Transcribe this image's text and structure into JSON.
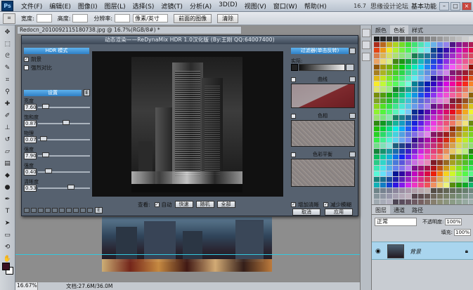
{
  "app": {
    "logo": "Ps",
    "menu": [
      "文件(F)",
      "编辑(E)",
      "图像(I)",
      "图层(L)",
      "选择(S)",
      "滤镜(T)",
      "分析(A)",
      "3D(D)",
      "视图(V)",
      "窗口(W)",
      "帮助(H)"
    ],
    "zoom_display": "16.7",
    "site_watermark": "思缘设计论坛",
    "workspace": "基本功能"
  },
  "options_bar": {
    "width_label": "宽度:",
    "height_label": "高度:",
    "resolution_label": "分辨率:",
    "unit_select": "像素/英寸",
    "front_image_button": "前面的图像",
    "clear_button": "清除"
  },
  "document": {
    "tab": "Redocn_2010092115180738.jpg @ 16.7%(RGB/8#) *",
    "zoom": "16.67%",
    "doc_info": "文档:27.6M/36.0M"
  },
  "dialog": {
    "title": "动态渲染——ReDynaMix HDR 1.0汉化版 (By:王刚  QQ:64007400)",
    "hdr_mode": "HDR 模式",
    "checks": [
      {
        "label": "阴景",
        "checked": true
      },
      {
        "label": "强烈对比",
        "checked": false
      }
    ],
    "settings_header": "设置",
    "settings_btn": "E",
    "params": [
      {
        "label": "亮度",
        "value": "7.60",
        "level": 0.1
      },
      {
        "label": "饱和度",
        "value": "0.87",
        "level": 0.55
      },
      {
        "label": "物理",
        "value": "0.07",
        "level": 0.05
      },
      {
        "label": "强度",
        "value": "7.90",
        "level": 0.1
      },
      {
        "label": "强度",
        "value": "0.40",
        "level": 0.15
      },
      {
        "label": "清晰度",
        "value": "0.53",
        "level": 0.65
      }
    ],
    "left_bottom_btn": "E",
    "view_label": "查看:",
    "auto_label": "自动",
    "auto_checked": true,
    "view_buttons": [
      "快速",
      "随机",
      "全部"
    ],
    "filter_header": "过滤器(单击反转)",
    "gradient_label": "实际:",
    "sections": [
      {
        "title": "曲线",
        "checked": false
      },
      {
        "title": "色相",
        "checked": false
      },
      {
        "title": "色彩平衡",
        "checked": false
      }
    ],
    "bottom_checks": [
      {
        "label": "增加清晰",
        "checked": true
      },
      {
        "label": "减少模糊",
        "checked": true
      }
    ],
    "ok_buttons": [
      "取消",
      "应用"
    ]
  },
  "panels": {
    "swatch_tabs": [
      "颜色",
      "色板",
      "样式"
    ],
    "layer_tabs": [
      "图层",
      "通道",
      "路径"
    ],
    "blend_mode": "正常",
    "opacity_label": "不透明度:",
    "opacity_value": "100%",
    "fill_label": "填充:",
    "fill_value": "100%",
    "layer_name": "背景"
  }
}
